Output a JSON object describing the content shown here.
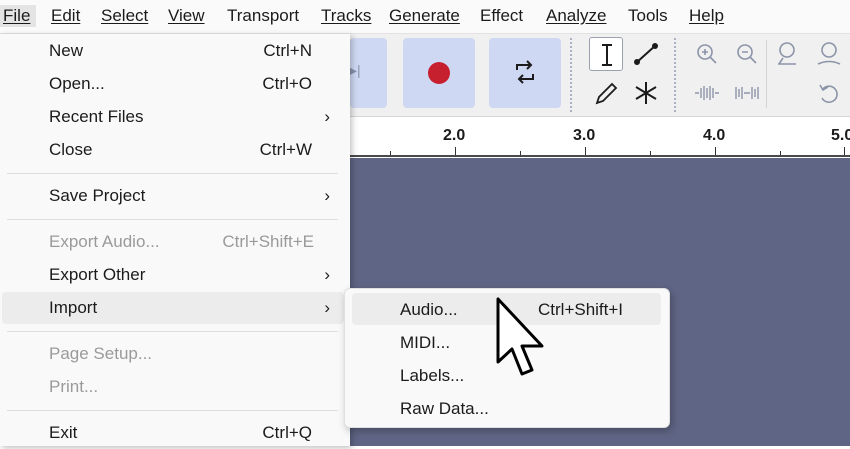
{
  "menubar": [
    {
      "label": "File"
    },
    {
      "label": "Edit"
    },
    {
      "label": "Select"
    },
    {
      "label": "View"
    },
    {
      "label": "Transport"
    },
    {
      "label": "Tracks"
    },
    {
      "label": "Generate"
    },
    {
      "label": "Effect"
    },
    {
      "label": "Analyze"
    },
    {
      "label": "Tools"
    },
    {
      "label": "Help"
    }
  ],
  "file_menu": {
    "new": {
      "label": "New",
      "shortcut": "Ctrl+N"
    },
    "open": {
      "label": "Open...",
      "shortcut": "Ctrl+O"
    },
    "recent": {
      "label": "Recent Files",
      "arrow": "›"
    },
    "close": {
      "label": "Close",
      "shortcut": "Ctrl+W"
    },
    "save_project": {
      "label": "Save Project",
      "arrow": "›"
    },
    "export_audio": {
      "label": "Export Audio...",
      "shortcut": "Ctrl+Shift+E"
    },
    "export_other": {
      "label": "Export Other",
      "arrow": "›"
    },
    "import": {
      "label": "Import",
      "arrow": "›"
    },
    "page_setup": {
      "label": "Page Setup..."
    },
    "print": {
      "label": "Print..."
    },
    "exit": {
      "label": "Exit",
      "shortcut": "Ctrl+Q"
    }
  },
  "import_submenu": {
    "audio": {
      "label": "Audio...",
      "shortcut": "Ctrl+Shift+I"
    },
    "midi": {
      "label": "MIDI..."
    },
    "labels": {
      "label": "Labels..."
    },
    "raw_data": {
      "label": "Raw Data..."
    }
  },
  "ruler": {
    "labels": [
      "2.0",
      "3.0",
      "4.0",
      "5.0"
    ]
  },
  "toolbar": {
    "skip_glyph": "▸|"
  },
  "colors": {
    "accent_button": "#cfd8f3",
    "record": "#c6202f",
    "track_background": "#5f6584",
    "menu_highlight": "#ececec"
  }
}
